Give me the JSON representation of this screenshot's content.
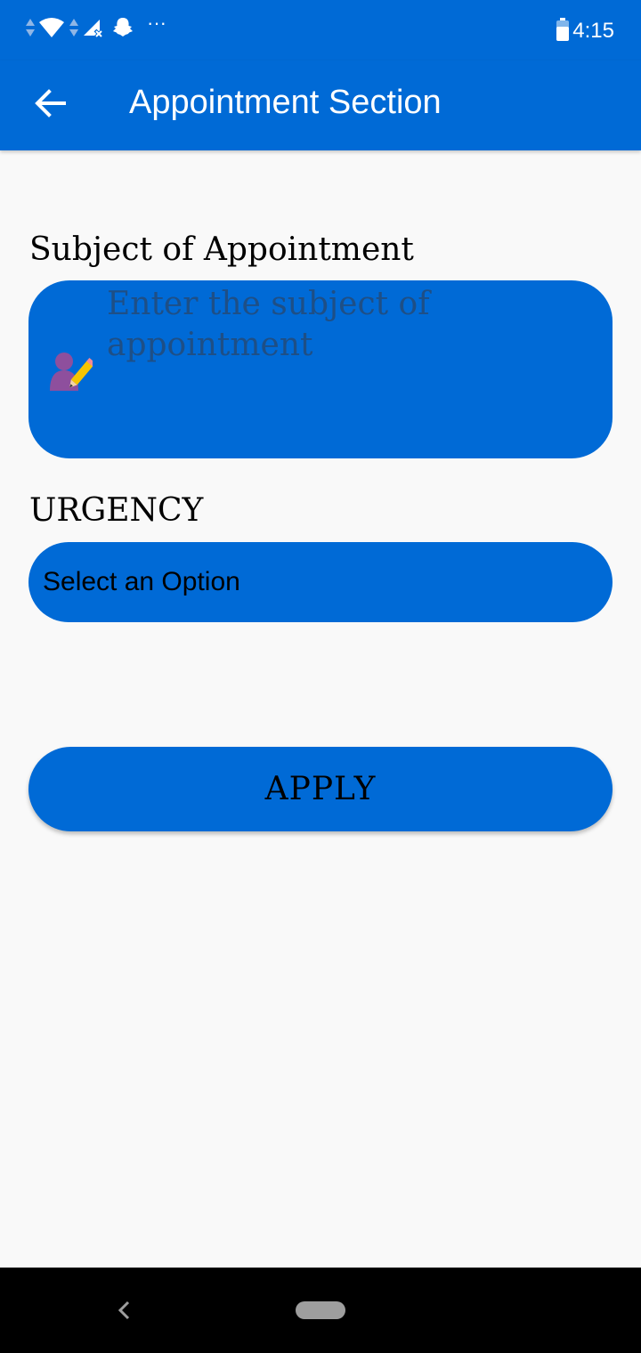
{
  "status_bar": {
    "time": "4:15",
    "icons": [
      "data-arrows-icon",
      "wifi-icon",
      "data-arrows-icon",
      "cell-signal-off-icon",
      "snapchat-icon",
      "more-notifications-icon",
      "battery-icon"
    ],
    "overflow_glyph": "···"
  },
  "app_bar": {
    "title": "Appointment Section",
    "back_icon": "arrow-back-icon"
  },
  "form": {
    "subject_label": "Subject of Appointment",
    "subject_placeholder": "Enter the subject of appointment",
    "subject_value": "",
    "subject_icon": "person-pencil-icon",
    "urgency_label": "URGENCY",
    "urgency_selected": "Select an Option",
    "apply_label": "APPLY"
  },
  "nav_bar": {
    "icons": [
      "nav-back-icon",
      "home-pill-icon"
    ]
  },
  "colors": {
    "primary": "#006ad6",
    "background": "#f9f9f9",
    "placeholder": "#1e4f86",
    "text": "#000000"
  }
}
